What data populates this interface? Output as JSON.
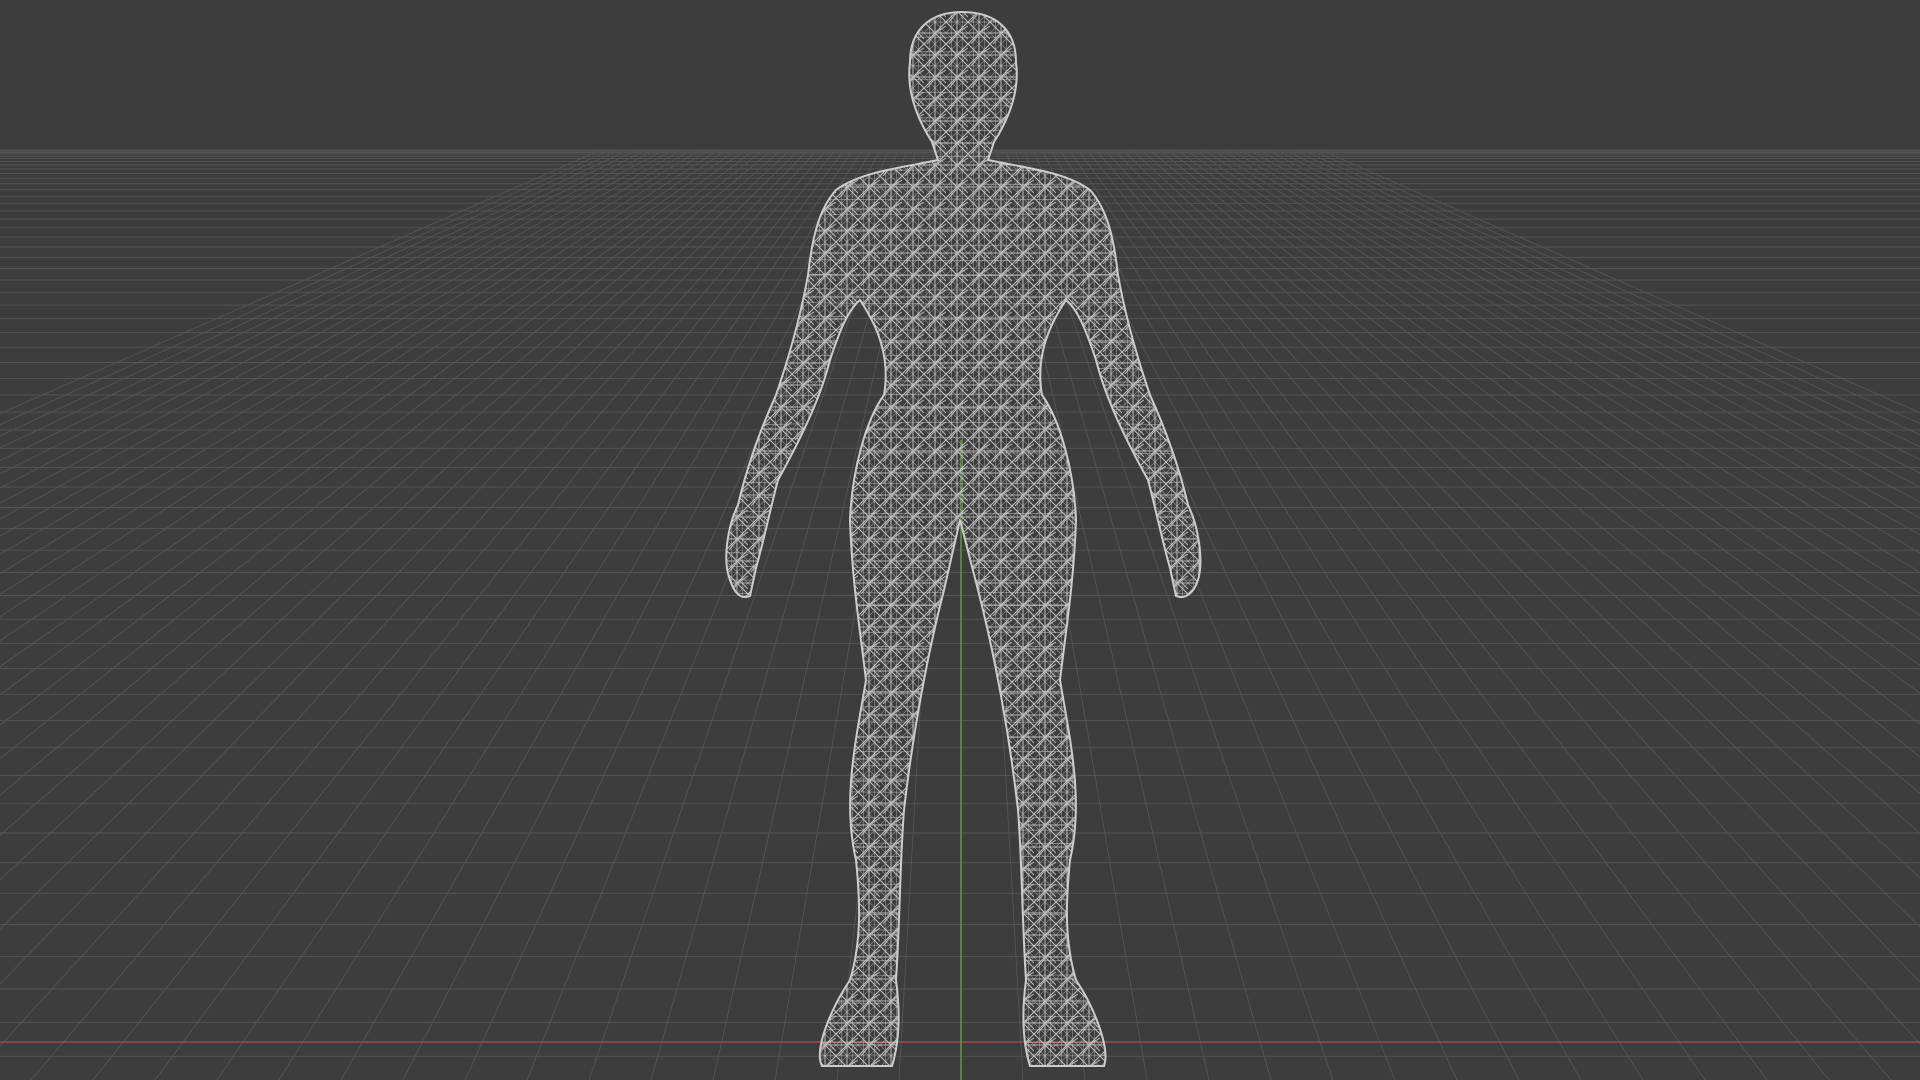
{
  "viewport": {
    "view": "front",
    "shading": "wireframe",
    "background_color": "#3d3d3d",
    "grid_color": "#555555",
    "x_axis_color": "#a8454c",
    "y_axis_color": "#6f9a3a",
    "wire_color": "#c8c8c8",
    "object": "human body mesh"
  }
}
